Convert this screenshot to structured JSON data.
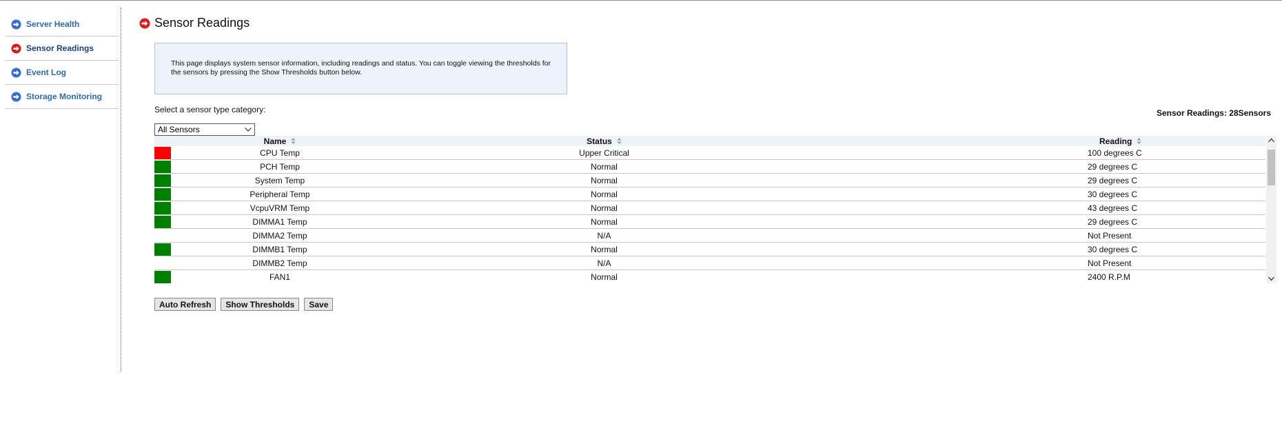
{
  "sidebar": {
    "items": [
      {
        "label": "Server Health",
        "active": false
      },
      {
        "label": "Sensor Readings",
        "active": true
      },
      {
        "label": "Event Log",
        "active": false
      },
      {
        "label": "Storage Monitoring",
        "active": false
      }
    ]
  },
  "page": {
    "title": "Sensor Readings",
    "description": "This page displays system sensor information, including readings and status. You can toggle viewing the thresholds for the sensors by pressing the Show Thresholds button below.",
    "select_label": "Select a sensor type category:",
    "sensor_count": "Sensor Readings: 28Sensors",
    "category_value": "All Sensors"
  },
  "table": {
    "headers": {
      "name": "Name",
      "status": "Status",
      "reading": "Reading"
    },
    "rows": [
      {
        "indicator": "red",
        "name": "CPU Temp",
        "status": "Upper Critical",
        "reading": "100 degrees C"
      },
      {
        "indicator": "green",
        "name": "PCH Temp",
        "status": "Normal",
        "reading": "29 degrees C"
      },
      {
        "indicator": "green",
        "name": "System Temp",
        "status": "Normal",
        "reading": "29 degrees C"
      },
      {
        "indicator": "green",
        "name": "Peripheral Temp",
        "status": "Normal",
        "reading": "30 degrees C"
      },
      {
        "indicator": "green",
        "name": "VcpuVRM Temp",
        "status": "Normal",
        "reading": "43 degrees C"
      },
      {
        "indicator": "green",
        "name": "DIMMA1 Temp",
        "status": "Normal",
        "reading": "29 degrees C"
      },
      {
        "indicator": "none",
        "name": "DIMMA2 Temp",
        "status": "N/A",
        "reading": "Not Present"
      },
      {
        "indicator": "green",
        "name": "DIMMB1 Temp",
        "status": "Normal",
        "reading": "30 degrees C"
      },
      {
        "indicator": "none",
        "name": "DIMMB2 Temp",
        "status": "N/A",
        "reading": "Not Present"
      },
      {
        "indicator": "green",
        "name": "FAN1",
        "status": "Normal",
        "reading": "2400 R.P.M"
      }
    ]
  },
  "buttons": {
    "auto_refresh": "Auto Refresh",
    "show_thresholds": "Show Thresholds",
    "save": "Save"
  },
  "colors": {
    "red": "#ff0000",
    "green": "#008000",
    "link": "#2c6bb5",
    "nav_icon_blue": "#2f6fd6",
    "nav_icon_red": "#e01919"
  },
  "icons": {
    "nav_inactive": "arrow-circle-right-blue-icon",
    "nav_active": "arrow-circle-right-red-icon",
    "sort": "sort-icon"
  }
}
